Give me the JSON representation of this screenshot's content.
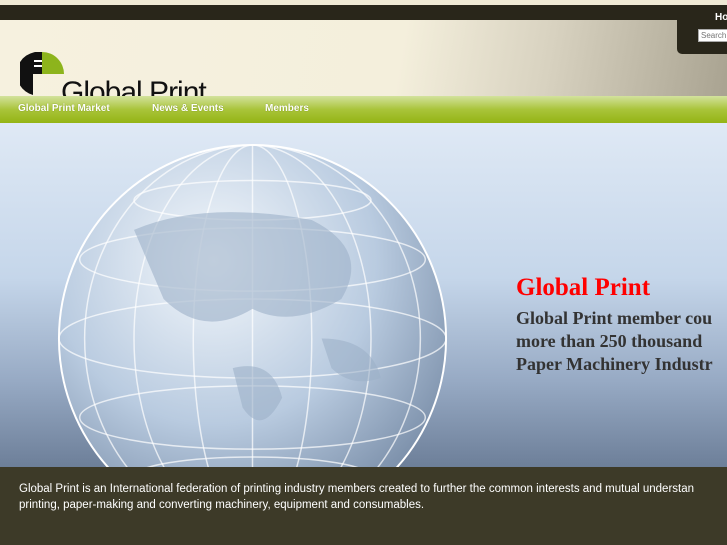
{
  "topbar": {
    "home_link": "Home"
  },
  "search": {
    "placeholder": "Search"
  },
  "logo": {
    "text": "Global Print"
  },
  "nav": {
    "items": [
      "Global Print Market",
      "News & Events",
      "Members"
    ]
  },
  "hero": {
    "title": "Global Print",
    "lines": [
      "Global Print member cou",
      "more than 250 thousand",
      "Paper Machinery Industr"
    ]
  },
  "footer": {
    "lines": [
      "Global Print is an International federation of printing industry members created to further the common interests and mutual understan",
      "printing, paper-making and converting machinery, equipment and consumables."
    ]
  }
}
